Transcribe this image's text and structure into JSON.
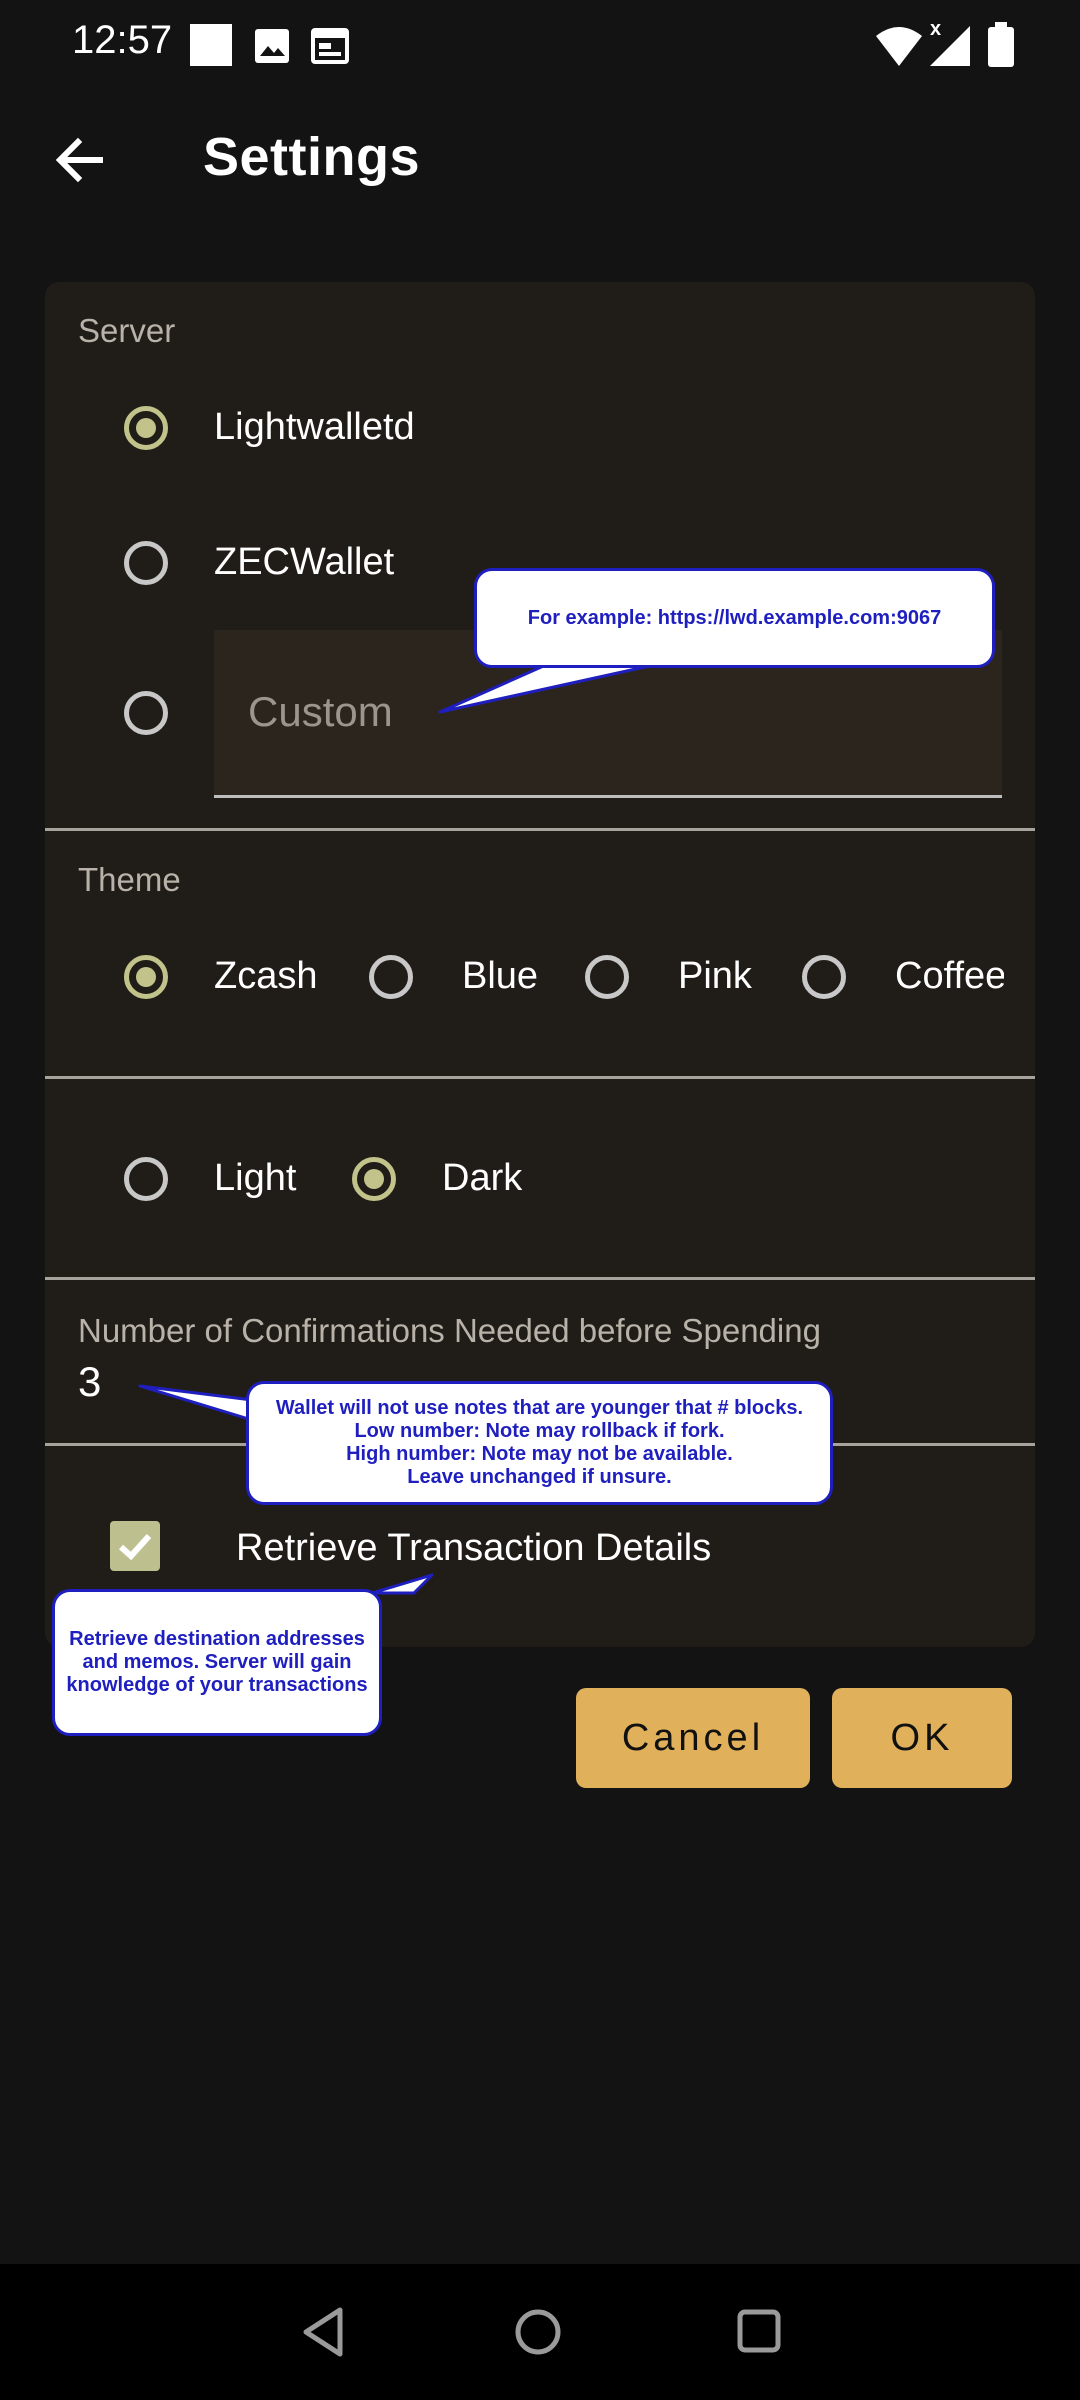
{
  "status_bar": {
    "time": "12:57",
    "icons": [
      "square-notification-icon",
      "image-icon",
      "calendar-icon",
      "wifi-icon",
      "signal-icon",
      "battery-icon"
    ]
  },
  "app_bar": {
    "title": "Settings",
    "back_icon": "arrow-back-icon"
  },
  "server": {
    "label": "Server",
    "options": [
      {
        "label": "Lightwalletd",
        "selected": true
      },
      {
        "label": "ZECWallet",
        "selected": false
      }
    ],
    "custom": {
      "placeholder": "Custom",
      "selected": false
    }
  },
  "theme": {
    "label": "Theme",
    "options": [
      {
        "label": "Zcash",
        "selected": true
      },
      {
        "label": "Blue",
        "selected": false
      },
      {
        "label": "Pink",
        "selected": false
      },
      {
        "label": "Coffee",
        "selected": false
      }
    ],
    "brightness": [
      {
        "label": "Light",
        "selected": false
      },
      {
        "label": "Dark",
        "selected": true
      }
    ]
  },
  "confirmations": {
    "label": "Number of Confirmations Needed before Spending",
    "value": "3"
  },
  "retrieve": {
    "label": "Retrieve Transaction Details",
    "checked": true
  },
  "buttons": {
    "cancel": "Cancel",
    "ok": "OK"
  },
  "tooltips": {
    "server": "For example: https://lwd.example.com:9067",
    "confirmations": "Wallet will not use notes that are younger that # blocks.\nLow number: Note may rollback if fork.\nHigh number: Note may not be available.\nLeave unchanged if unsure.",
    "retrieve": "Retrieve destination addresses\nand memos. Server will gain\nknowledge of your transactions"
  },
  "nav_bar": {
    "icons": [
      "nav-back-icon",
      "nav-home-icon",
      "nav-recents-icon"
    ]
  },
  "colors": {
    "background": "#131313",
    "card": "#201c17",
    "accent": "#e0b05a",
    "radio_selected": "#c2c38a",
    "tooltip_text": "#1f1fbf"
  }
}
